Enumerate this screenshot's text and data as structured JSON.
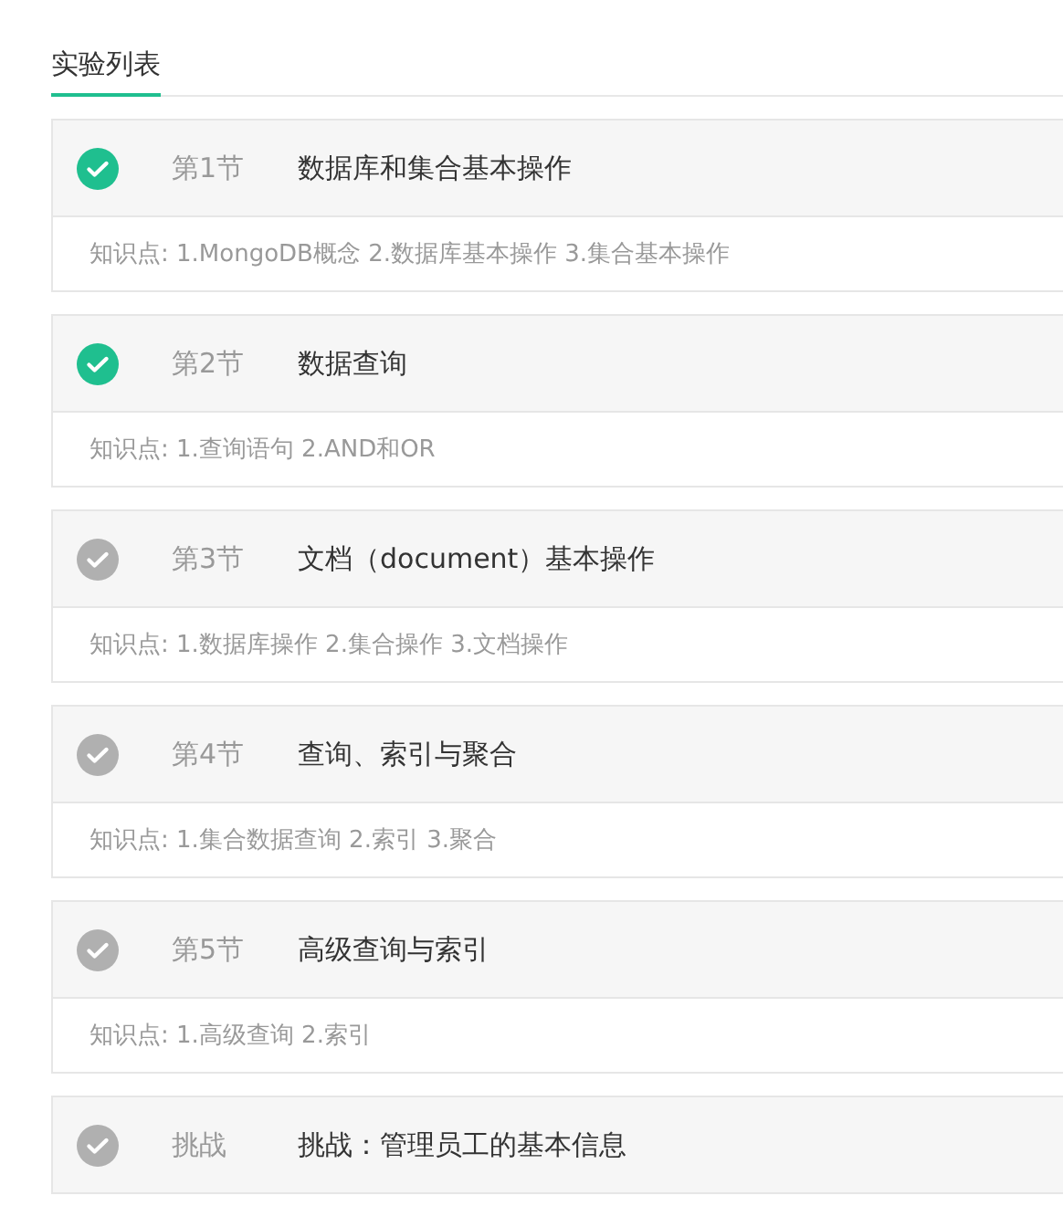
{
  "tabs": [
    {
      "label": "实验列表",
      "selected": true
    }
  ],
  "labs": [
    {
      "done": true,
      "section": "第1节",
      "title": "数据库和集合基本操作",
      "points": "知识点: 1.MongoDB概念 2.数据库基本操作 3.集合基本操作"
    },
    {
      "done": true,
      "section": "第2节",
      "title": "数据查询",
      "points": "知识点: 1.查询语句 2.AND和OR"
    },
    {
      "done": false,
      "section": "第3节",
      "title": "文档（document）基本操作",
      "points": "知识点: 1.数据库操作 2.集合操作 3.文档操作"
    },
    {
      "done": false,
      "section": "第4节",
      "title": "查询、索引与聚合",
      "points": "知识点: 1.集合数据查询 2.索引 3.聚合"
    },
    {
      "done": false,
      "section": "第5节",
      "title": "高级查询与索引",
      "points": "知识点: 1.高级查询 2.索引"
    },
    {
      "done": false,
      "section": "挑战",
      "title": "挑战：管理员工的基本信息"
    }
  ]
}
